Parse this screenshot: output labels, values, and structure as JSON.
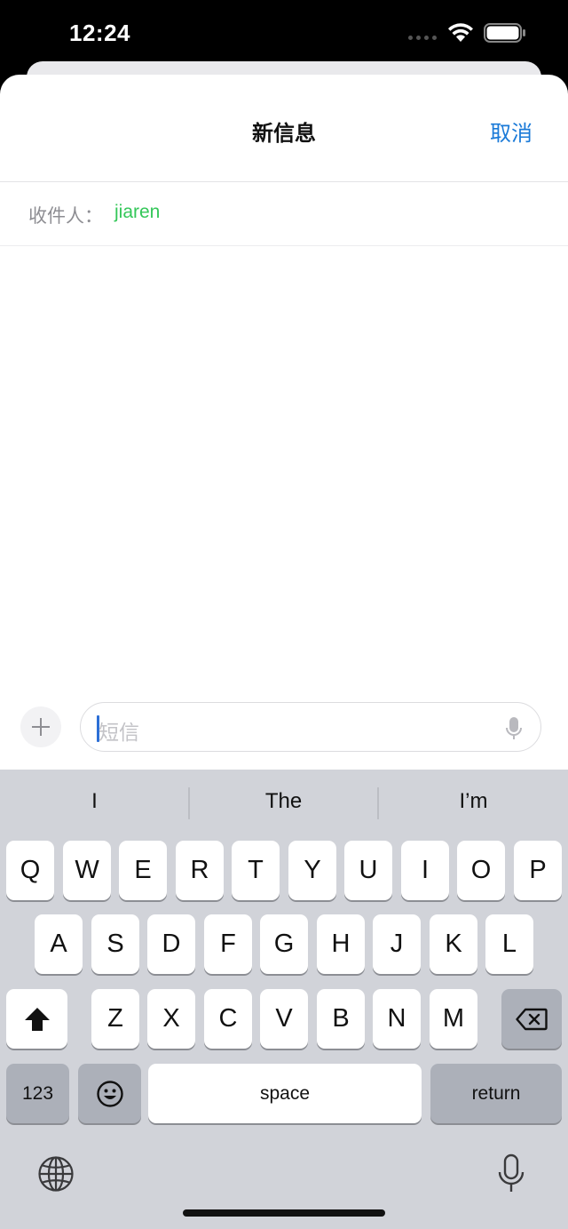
{
  "status_bar": {
    "time": "12:24"
  },
  "nav": {
    "title": "新信息",
    "cancel_label": "取消"
  },
  "recipient": {
    "label": "收件人：",
    "name": "jiaren"
  },
  "composer": {
    "placeholder": "短信"
  },
  "keyboard": {
    "suggestions": [
      "I",
      "The",
      "I’m"
    ],
    "row1": [
      "Q",
      "W",
      "E",
      "R",
      "T",
      "Y",
      "U",
      "I",
      "O",
      "P"
    ],
    "row2": [
      "A",
      "S",
      "D",
      "F",
      "G",
      "H",
      "J",
      "K",
      "L"
    ],
    "row3": [
      "Z",
      "X",
      "C",
      "V",
      "B",
      "N",
      "M"
    ],
    "numbers_label": "123",
    "space_label": "space",
    "return_label": "return"
  },
  "colors": {
    "accent_blue": "#1a7ad8",
    "recipient_green": "#34c759",
    "keyboard_bg": "#d1d3d9"
  }
}
